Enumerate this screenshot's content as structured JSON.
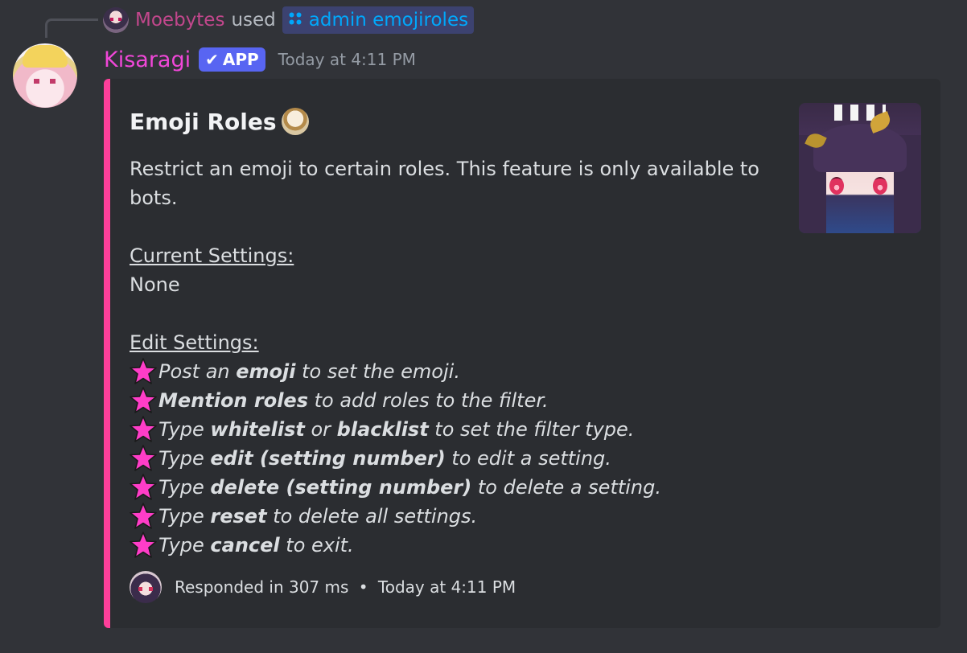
{
  "reply": {
    "user": "Moebytes",
    "used": "used",
    "command": "admin emojiroles"
  },
  "message": {
    "author": "Kisaragi",
    "badge": "APP",
    "timestamp": "Today at 4:11 PM"
  },
  "embed": {
    "accent_color": "#fd3f9a",
    "title": "Emoji Roles",
    "description_line1": "Restrict an emoji to certain roles. This feature is only available to",
    "description_line2": "bots.",
    "current_settings_label": "Current Settings:",
    "current_settings_value": "None",
    "edit_settings_label": "Edit Settings:",
    "instructions": [
      {
        "before": "Post an ",
        "bold1": "emoji",
        "middle": " to set the emoji.",
        "bold2": "",
        "after": ""
      },
      {
        "before": "",
        "bold1": "Mention roles",
        "middle": " to add roles to the filter.",
        "bold2": "",
        "after": ""
      },
      {
        "before": "Type ",
        "bold1": "whitelist",
        "middle": " or ",
        "bold2": "blacklist",
        "after": " to set the filter type."
      },
      {
        "before": "Type ",
        "bold1": "edit (setting number)",
        "middle": " to edit a setting.",
        "bold2": "",
        "after": ""
      },
      {
        "before": "Type ",
        "bold1": "delete (setting number)",
        "middle": " to delete a setting.",
        "bold2": "",
        "after": ""
      },
      {
        "before": "Type ",
        "bold1": "reset",
        "middle": " to delete all settings.",
        "bold2": "",
        "after": ""
      },
      {
        "before": "Type ",
        "bold1": "cancel",
        "middle": " to exit.",
        "bold2": "",
        "after": ""
      }
    ],
    "footer_text": "Responded in 307 ms",
    "footer_separator": "•",
    "footer_time": "Today at 4:11 PM"
  }
}
